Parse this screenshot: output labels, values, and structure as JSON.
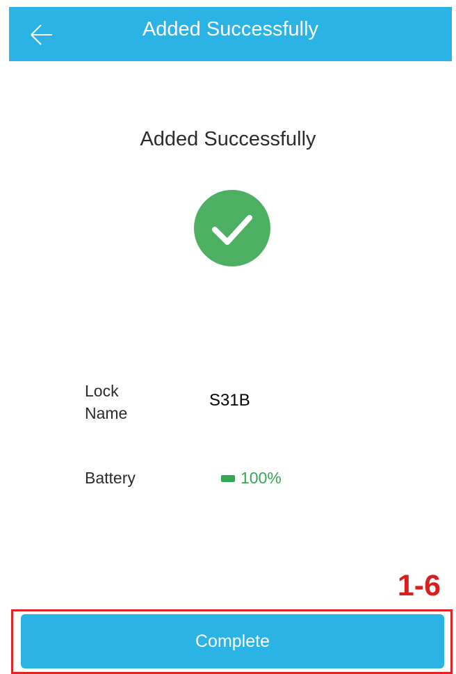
{
  "header": {
    "title": "Added Successfully",
    "back_icon": "arrow-left-icon"
  },
  "main": {
    "success_title": "Added Successfully",
    "success_icon": "check-circle-icon",
    "success_color": "#4caf62",
    "lock_name_label": "Lock\nName",
    "lock_name_value": "S31B",
    "battery_label": "Battery",
    "battery_value": "100%",
    "battery_level": 1.0,
    "battery_color": "#33a852"
  },
  "annotation": {
    "label": "1-6",
    "color": "#e02424"
  },
  "footer": {
    "complete_label": "Complete"
  },
  "colors": {
    "accent": "#2bb3e6"
  }
}
